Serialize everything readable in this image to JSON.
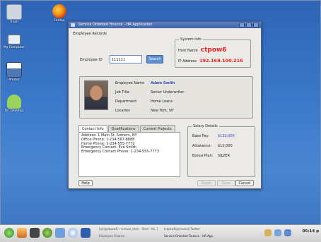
{
  "desktop": {
    "icons": [
      {
        "label": "Trash",
        "icon": "trash-icon",
        "color": "#cfd6df"
      },
      {
        "label": "Firefox",
        "icon": "firefox-icon",
        "color": "#e06a16"
      },
      {
        "label": "My Computer",
        "icon": "computer-icon",
        "color": "#e8eef8"
      },
      {
        "label": "Printer",
        "icon": "printer-icon",
        "color": "#f2f2f2"
      },
      {
        "label": "Dr. Desktop",
        "icon": "doctor-icon",
        "color": "#9ad35a"
      }
    ]
  },
  "window": {
    "title": "Service Oriented Finance - HR Application",
    "heading": "Employee Records",
    "employee_id_label": "Employee ID",
    "employee_id_value": "111111",
    "search_label": "Search",
    "system_info": {
      "title": "System Info",
      "host_label": "Host Name",
      "host_value": "ctpow6",
      "ip_label": "IP Address",
      "ip_value": "192.168.100.216"
    },
    "employee": {
      "name_label": "Employee Name",
      "name_value": "Adam Smith",
      "title_label": "Job Title",
      "title_value": "Senior Underwriter",
      "dept_label": "Department",
      "dept_value": "Home Loans",
      "loc_label": "Location",
      "loc_value": "New York, NY"
    },
    "tabs": [
      "Contact Info",
      "Qualifications",
      "Current Projects"
    ],
    "contact_lines": [
      "Address: 1 Main St, Somers, NY",
      "Office Phone: 1-234-567-8888",
      "Home Phone: 1-234-555-7772",
      "Emergency Contact: Eve Smith",
      "Emergency Contact Phone: 1-234-555-7773"
    ],
    "salary": {
      "title": "Salary Details",
      "base_label": "Base Pay:",
      "base_value": "$120,000",
      "allow_label": "Allowance:",
      "allow_value": "$12,000",
      "bonus_label": "Bonus Plan:",
      "bonus_value": "SILVER"
    },
    "buttons": {
      "help": "Help",
      "b2": "Reset",
      "b3": "Save",
      "cancel": "Cancel"
    }
  },
  "taskbar": {
    "task1": "[anl@ctpow6:~/virtual_desk - Shell - Ko..]",
    "task2": "Employee Finance",
    "task3": "[ctpow6/personal] Twitter",
    "task4": "Service Oriented Finance - HR App",
    "clock": "05:14 p"
  }
}
